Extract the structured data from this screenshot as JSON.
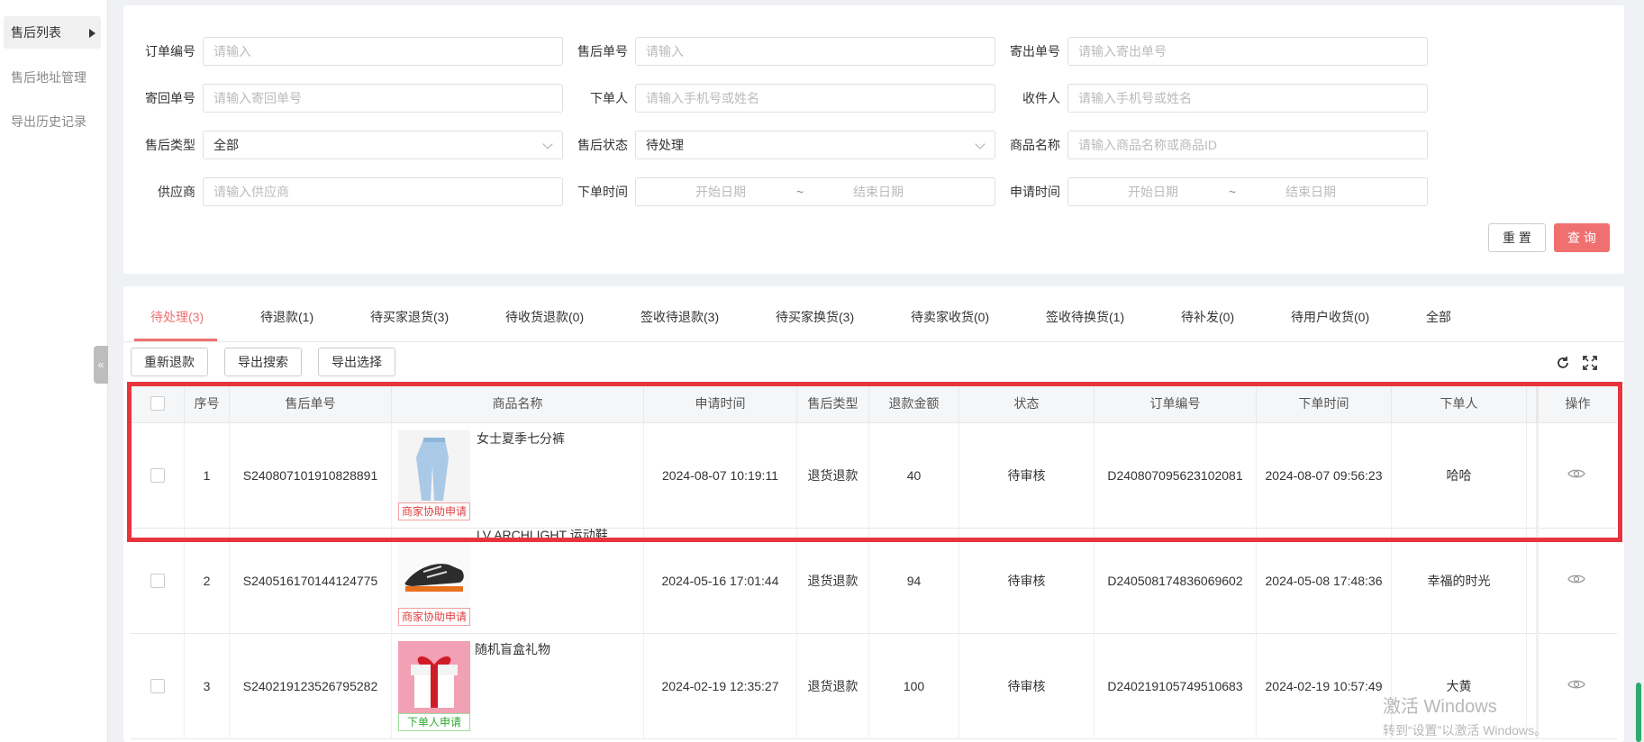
{
  "sidebar": {
    "items": [
      {
        "label": "售后列表"
      },
      {
        "label": "售后地址管理"
      },
      {
        "label": "导出历史记录"
      }
    ],
    "collapse_glyph": "«"
  },
  "filters": {
    "order_no": {
      "label": "订单编号",
      "placeholder": "请输入"
    },
    "aftersale_no": {
      "label": "售后单号",
      "placeholder": "请输入"
    },
    "send_no": {
      "label": "寄出单号",
      "placeholder": "请输入寄出单号"
    },
    "return_no": {
      "label": "寄回单号",
      "placeholder": "请输入寄回单号"
    },
    "buyer": {
      "label": "下单人",
      "placeholder": "请输入手机号或姓名"
    },
    "receiver": {
      "label": "收件人",
      "placeholder": "请输入手机号或姓名"
    },
    "aftersale_type": {
      "label": "售后类型",
      "value": "全部"
    },
    "aftersale_status": {
      "label": "售后状态",
      "value": "待处理"
    },
    "product_name": {
      "label": "商品名称",
      "placeholder": "请输入商品名称或商品ID"
    },
    "supplier": {
      "label": "供应商",
      "placeholder": "请输入供应商"
    },
    "order_time": {
      "label": "下单时间",
      "start": "开始日期",
      "sep": "~",
      "end": "结束日期"
    },
    "apply_time": {
      "label": "申请时间",
      "start": "开始日期",
      "sep": "~",
      "end": "结束日期"
    },
    "reset_label": "重 置",
    "query_label": "查 询"
  },
  "tabs": [
    "待处理(3)",
    "待退款(1)",
    "待买家退货(3)",
    "待收货退款(0)",
    "签收待退款(3)",
    "待买家换货(3)",
    "待卖家收货(0)",
    "签收待换货(1)",
    "待补发(0)",
    "待用户收货(0)",
    "全部"
  ],
  "toolbar": {
    "re_refund": "重新退款",
    "export_search": "导出搜索",
    "export_selected": "导出选择",
    "refresh_icon": "refresh-icon",
    "fullscreen_icon": "fullscreen-icon"
  },
  "table": {
    "headers": [
      "序号",
      "售后单号",
      "商品名称",
      "申请时间",
      "售后类型",
      "退款金额",
      "状态",
      "订单编号",
      "下单时间",
      "下单人",
      "操作"
    ],
    "rows": [
      {
        "index": "1",
        "aftersale_no": "S240807101910828891",
        "product_name": "女士夏季七分裤",
        "thumb_text": "",
        "tag": "商家协助申请",
        "apply_time": "2024-08-07 10:19:11",
        "type": "退货退款",
        "amount": "40",
        "status": "待审核",
        "order_no": "D240807095623102081",
        "order_time": "2024-08-07 09:56:23",
        "buyer": "哈哈"
      },
      {
        "index": "2",
        "aftersale_no": "S240516170144124775",
        "product_name": "LV ARCHLIGHT 运动鞋",
        "thumb_text": "",
        "tag": "商家协助申请",
        "apply_time": "2024-05-16 17:01:44",
        "type": "退货退款",
        "amount": "94",
        "status": "待审核",
        "order_no": "D240508174836069602",
        "order_time": "2024-05-08 17:48:36",
        "buyer": "幸福的时光"
      },
      {
        "index": "3",
        "aftersale_no": "S240219123526795282",
        "product_name": "随机盲盒礼物",
        "thumb_text": "",
        "tag": "下单人申请",
        "apply_time": "2024-02-19 12:35:27",
        "type": "退货退款",
        "amount": "100",
        "status": "待审核",
        "order_no": "D240219105749510683",
        "order_time": "2024-02-19 10:57:49",
        "buyer": "大黄"
      }
    ]
  },
  "watermark": {
    "line1": "激活 Windows",
    "line2": "转到“设置”以激活 Windows。"
  },
  "colors": {
    "accent": "#f07070",
    "highlight": "#e8343c",
    "tag_red": "#e04040",
    "tag_green": "#2faa2f"
  }
}
